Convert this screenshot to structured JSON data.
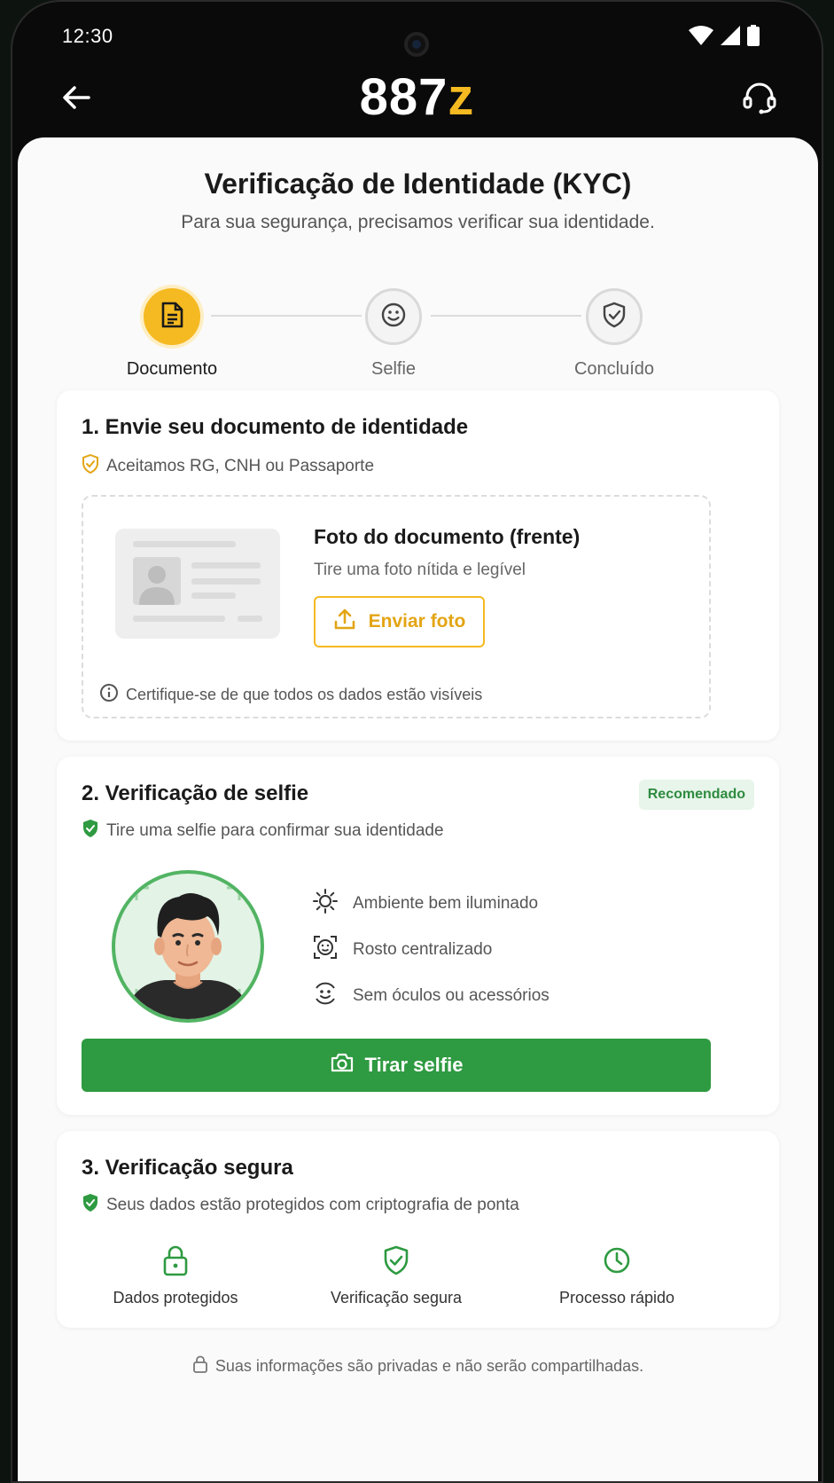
{
  "status_bar": {
    "time": "12:30"
  },
  "brand": {
    "logo_main": "887",
    "logo_accent": "z",
    "accent_color": "#f5b921"
  },
  "header": {
    "title": "Verificação de Identidade (KYC)",
    "subtitle": "Para sua segurança, precisamos verificar sua identidade."
  },
  "steps": [
    {
      "label": "Documento",
      "icon": "document-icon",
      "state": "active"
    },
    {
      "label": "Selfie",
      "icon": "smile-icon",
      "state": "pending"
    },
    {
      "label": "Concluído",
      "icon": "shield-check-icon",
      "state": "pending"
    }
  ],
  "document_card": {
    "title": "1. Envie seu documento de identidade",
    "subtitle": "Aceitamos RG, CNH ou Passaporte",
    "upload_title": "Foto do documento (frente)",
    "upload_subtitle": "Tire uma foto nítida e legível",
    "upload_button": "Enviar foto",
    "note": "Certifique-se de que todos os dados estão visíveis"
  },
  "selfie_card": {
    "title": "2. Verificação de selfie",
    "badge": "Recomendado",
    "subtitle": "Tire uma selfie para confirmar sua identidade",
    "tips": [
      {
        "icon": "sun-icon",
        "text": "Ambiente bem iluminado"
      },
      {
        "icon": "face-frame-icon",
        "text": "Rosto centralizado"
      },
      {
        "icon": "smile-icon",
        "text": "Sem óculos ou acessórios"
      }
    ],
    "button": "Tirar selfie",
    "accent_color": "#2e9a41"
  },
  "secure_card": {
    "title": "3. Verificação segura",
    "subtitle": "Seus dados estão protegidos com criptografia de ponta",
    "features": [
      {
        "icon": "lock-icon",
        "label": "Dados protegidos"
      },
      {
        "icon": "shield-check-icon",
        "label": "Verificação segura"
      },
      {
        "icon": "clock-icon",
        "label": "Processo rápido"
      }
    ]
  },
  "footer": {
    "text": "Suas informações são privadas e não serão compartilhadas."
  }
}
